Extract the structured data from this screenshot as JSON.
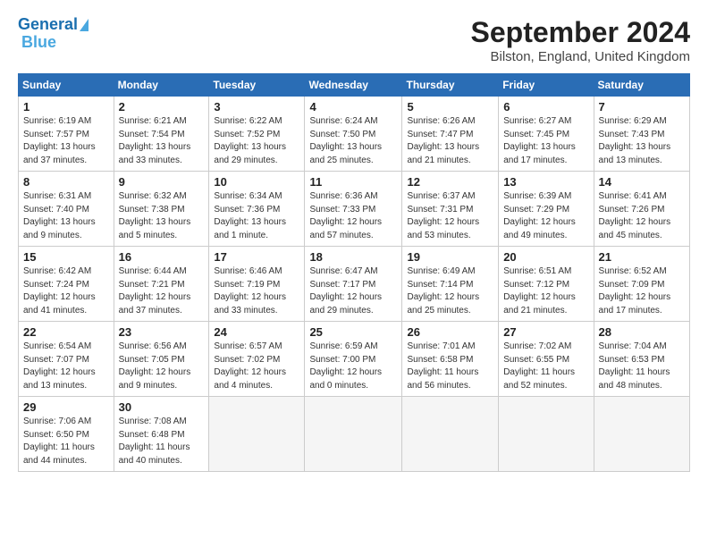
{
  "header": {
    "logo_line1": "General",
    "logo_line2": "Blue",
    "month": "September 2024",
    "location": "Bilston, England, United Kingdom"
  },
  "weekdays": [
    "Sunday",
    "Monday",
    "Tuesday",
    "Wednesday",
    "Thursday",
    "Friday",
    "Saturday"
  ],
  "weeks": [
    [
      {
        "day": "1",
        "info": "Sunrise: 6:19 AM\nSunset: 7:57 PM\nDaylight: 13 hours\nand 37 minutes."
      },
      {
        "day": "2",
        "info": "Sunrise: 6:21 AM\nSunset: 7:54 PM\nDaylight: 13 hours\nand 33 minutes."
      },
      {
        "day": "3",
        "info": "Sunrise: 6:22 AM\nSunset: 7:52 PM\nDaylight: 13 hours\nand 29 minutes."
      },
      {
        "day": "4",
        "info": "Sunrise: 6:24 AM\nSunset: 7:50 PM\nDaylight: 13 hours\nand 25 minutes."
      },
      {
        "day": "5",
        "info": "Sunrise: 6:26 AM\nSunset: 7:47 PM\nDaylight: 13 hours\nand 21 minutes."
      },
      {
        "day": "6",
        "info": "Sunrise: 6:27 AM\nSunset: 7:45 PM\nDaylight: 13 hours\nand 17 minutes."
      },
      {
        "day": "7",
        "info": "Sunrise: 6:29 AM\nSunset: 7:43 PM\nDaylight: 13 hours\nand 13 minutes."
      }
    ],
    [
      {
        "day": "8",
        "info": "Sunrise: 6:31 AM\nSunset: 7:40 PM\nDaylight: 13 hours\nand 9 minutes."
      },
      {
        "day": "9",
        "info": "Sunrise: 6:32 AM\nSunset: 7:38 PM\nDaylight: 13 hours\nand 5 minutes."
      },
      {
        "day": "10",
        "info": "Sunrise: 6:34 AM\nSunset: 7:36 PM\nDaylight: 13 hours\nand 1 minute."
      },
      {
        "day": "11",
        "info": "Sunrise: 6:36 AM\nSunset: 7:33 PM\nDaylight: 12 hours\nand 57 minutes."
      },
      {
        "day": "12",
        "info": "Sunrise: 6:37 AM\nSunset: 7:31 PM\nDaylight: 12 hours\nand 53 minutes."
      },
      {
        "day": "13",
        "info": "Sunrise: 6:39 AM\nSunset: 7:29 PM\nDaylight: 12 hours\nand 49 minutes."
      },
      {
        "day": "14",
        "info": "Sunrise: 6:41 AM\nSunset: 7:26 PM\nDaylight: 12 hours\nand 45 minutes."
      }
    ],
    [
      {
        "day": "15",
        "info": "Sunrise: 6:42 AM\nSunset: 7:24 PM\nDaylight: 12 hours\nand 41 minutes."
      },
      {
        "day": "16",
        "info": "Sunrise: 6:44 AM\nSunset: 7:21 PM\nDaylight: 12 hours\nand 37 minutes."
      },
      {
        "day": "17",
        "info": "Sunrise: 6:46 AM\nSunset: 7:19 PM\nDaylight: 12 hours\nand 33 minutes."
      },
      {
        "day": "18",
        "info": "Sunrise: 6:47 AM\nSunset: 7:17 PM\nDaylight: 12 hours\nand 29 minutes."
      },
      {
        "day": "19",
        "info": "Sunrise: 6:49 AM\nSunset: 7:14 PM\nDaylight: 12 hours\nand 25 minutes."
      },
      {
        "day": "20",
        "info": "Sunrise: 6:51 AM\nSunset: 7:12 PM\nDaylight: 12 hours\nand 21 minutes."
      },
      {
        "day": "21",
        "info": "Sunrise: 6:52 AM\nSunset: 7:09 PM\nDaylight: 12 hours\nand 17 minutes."
      }
    ],
    [
      {
        "day": "22",
        "info": "Sunrise: 6:54 AM\nSunset: 7:07 PM\nDaylight: 12 hours\nand 13 minutes."
      },
      {
        "day": "23",
        "info": "Sunrise: 6:56 AM\nSunset: 7:05 PM\nDaylight: 12 hours\nand 9 minutes."
      },
      {
        "day": "24",
        "info": "Sunrise: 6:57 AM\nSunset: 7:02 PM\nDaylight: 12 hours\nand 4 minutes."
      },
      {
        "day": "25",
        "info": "Sunrise: 6:59 AM\nSunset: 7:00 PM\nDaylight: 12 hours\nand 0 minutes."
      },
      {
        "day": "26",
        "info": "Sunrise: 7:01 AM\nSunset: 6:58 PM\nDaylight: 11 hours\nand 56 minutes."
      },
      {
        "day": "27",
        "info": "Sunrise: 7:02 AM\nSunset: 6:55 PM\nDaylight: 11 hours\nand 52 minutes."
      },
      {
        "day": "28",
        "info": "Sunrise: 7:04 AM\nSunset: 6:53 PM\nDaylight: 11 hours\nand 48 minutes."
      }
    ],
    [
      {
        "day": "29",
        "info": "Sunrise: 7:06 AM\nSunset: 6:50 PM\nDaylight: 11 hours\nand 44 minutes."
      },
      {
        "day": "30",
        "info": "Sunrise: 7:08 AM\nSunset: 6:48 PM\nDaylight: 11 hours\nand 40 minutes."
      },
      {
        "day": "",
        "info": ""
      },
      {
        "day": "",
        "info": ""
      },
      {
        "day": "",
        "info": ""
      },
      {
        "day": "",
        "info": ""
      },
      {
        "day": "",
        "info": ""
      }
    ]
  ]
}
